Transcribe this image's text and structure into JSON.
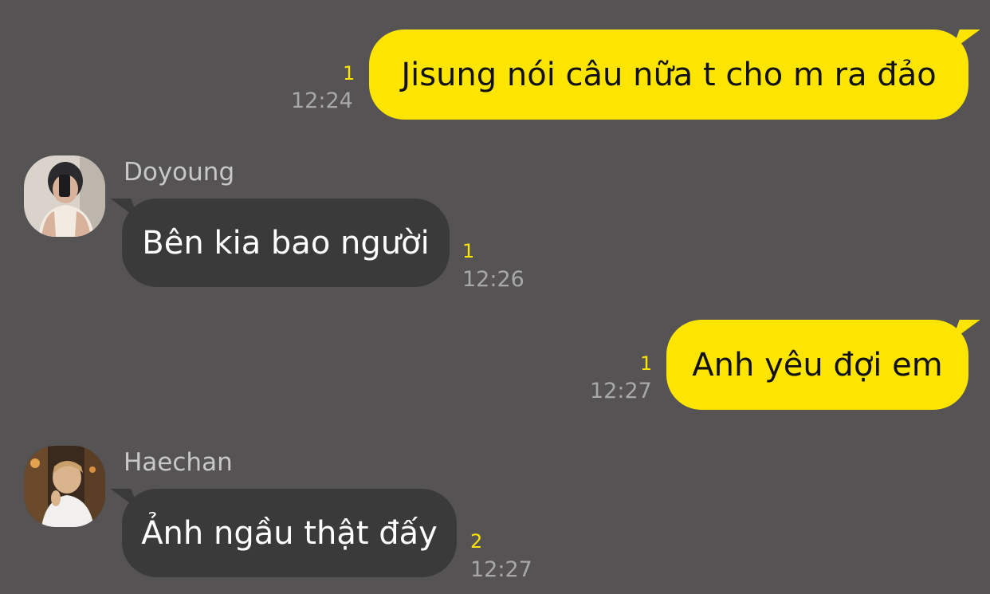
{
  "messages": [
    {
      "direction": "outgoing",
      "text": "Jisung nói câu nữa t cho m ra đảo",
      "unread": "1",
      "time": "12:24"
    },
    {
      "direction": "incoming",
      "sender": "Doyoung",
      "avatar_icon": "profile-photo-doyoung",
      "text": "Bên kia bao người",
      "unread": "1",
      "time": "12:26"
    },
    {
      "direction": "outgoing",
      "text": "Anh yêu đợi em",
      "unread": "1",
      "time": "12:27"
    },
    {
      "direction": "incoming",
      "sender": "Haechan",
      "avatar_icon": "profile-photo-haechan",
      "text": "Ảnh ngầu thật đấy",
      "unread": "2",
      "time": "12:27"
    }
  ],
  "colors": {
    "background": "#555354",
    "outgoing_bubble": "#FEE500",
    "incoming_bubble": "#3b3a3b",
    "unread_count": "#FEE500",
    "timestamp": "#a9a8a9"
  }
}
